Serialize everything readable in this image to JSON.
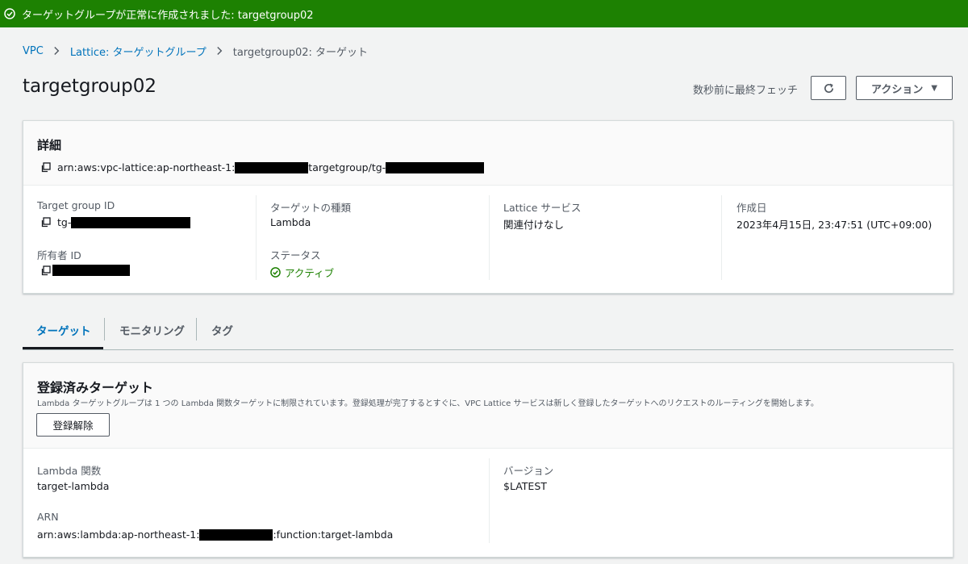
{
  "flash": {
    "message": "ターゲットグループが正常に作成されました: targetgroup02",
    "icon": "check-circle-icon",
    "color": "#1d8102"
  },
  "breadcrumb": [
    {
      "label": "VPC",
      "link": true
    },
    {
      "label": "Lattice: ターゲットグループ",
      "link": true
    },
    {
      "label": "targetgroup02: ターゲット",
      "link": false
    }
  ],
  "page": {
    "title": "targetgroup02",
    "fetch_text": "数秒前に最終フェッチ",
    "actions_label": "アクション"
  },
  "details": {
    "heading": "詳細",
    "arn_prefix": "arn:aws:vpc-lattice:ap-northeast-1:",
    "arn_middle": "targetgroup/tg-",
    "target_group_id_label": "Target group ID",
    "target_group_id_prefix": "tg-",
    "owner_id_label": "所有者 ID",
    "target_type_label": "ターゲットの種類",
    "target_type_value": "Lambda",
    "status_label": "ステータス",
    "status_value": "アクティブ",
    "lattice_service_label": "Lattice サービス",
    "lattice_service_value": "関連付けなし",
    "created_label": "作成日",
    "created_value": "2023年4月15日, 23:47:51 (UTC+09:00)"
  },
  "tabs": [
    {
      "label": "ターゲット",
      "active": true
    },
    {
      "label": "モニタリング",
      "active": false
    },
    {
      "label": "タグ",
      "active": false
    }
  ],
  "targets": {
    "heading": "登録済みターゲット",
    "description": "Lambda ターゲットグループは 1 つの Lambda 関数ターゲットに制限されています。登録処理が完了するとすぐに、VPC Lattice サービスは新しく登録したターゲットへのリクエストのルーティングを開始します。",
    "deregister_label": "登録解除",
    "lambda_label": "Lambda 関数",
    "lambda_value": "target-lambda",
    "version_label": "バージョン",
    "version_value": "$LATEST",
    "arn_label": "ARN",
    "arn_prefix": "arn:aws:lambda:ap-northeast-1:",
    "arn_suffix": ":function:target-lambda"
  },
  "colors": {
    "link": "#0073bb",
    "success": "#1d8102",
    "background": "#f2f3f3"
  }
}
